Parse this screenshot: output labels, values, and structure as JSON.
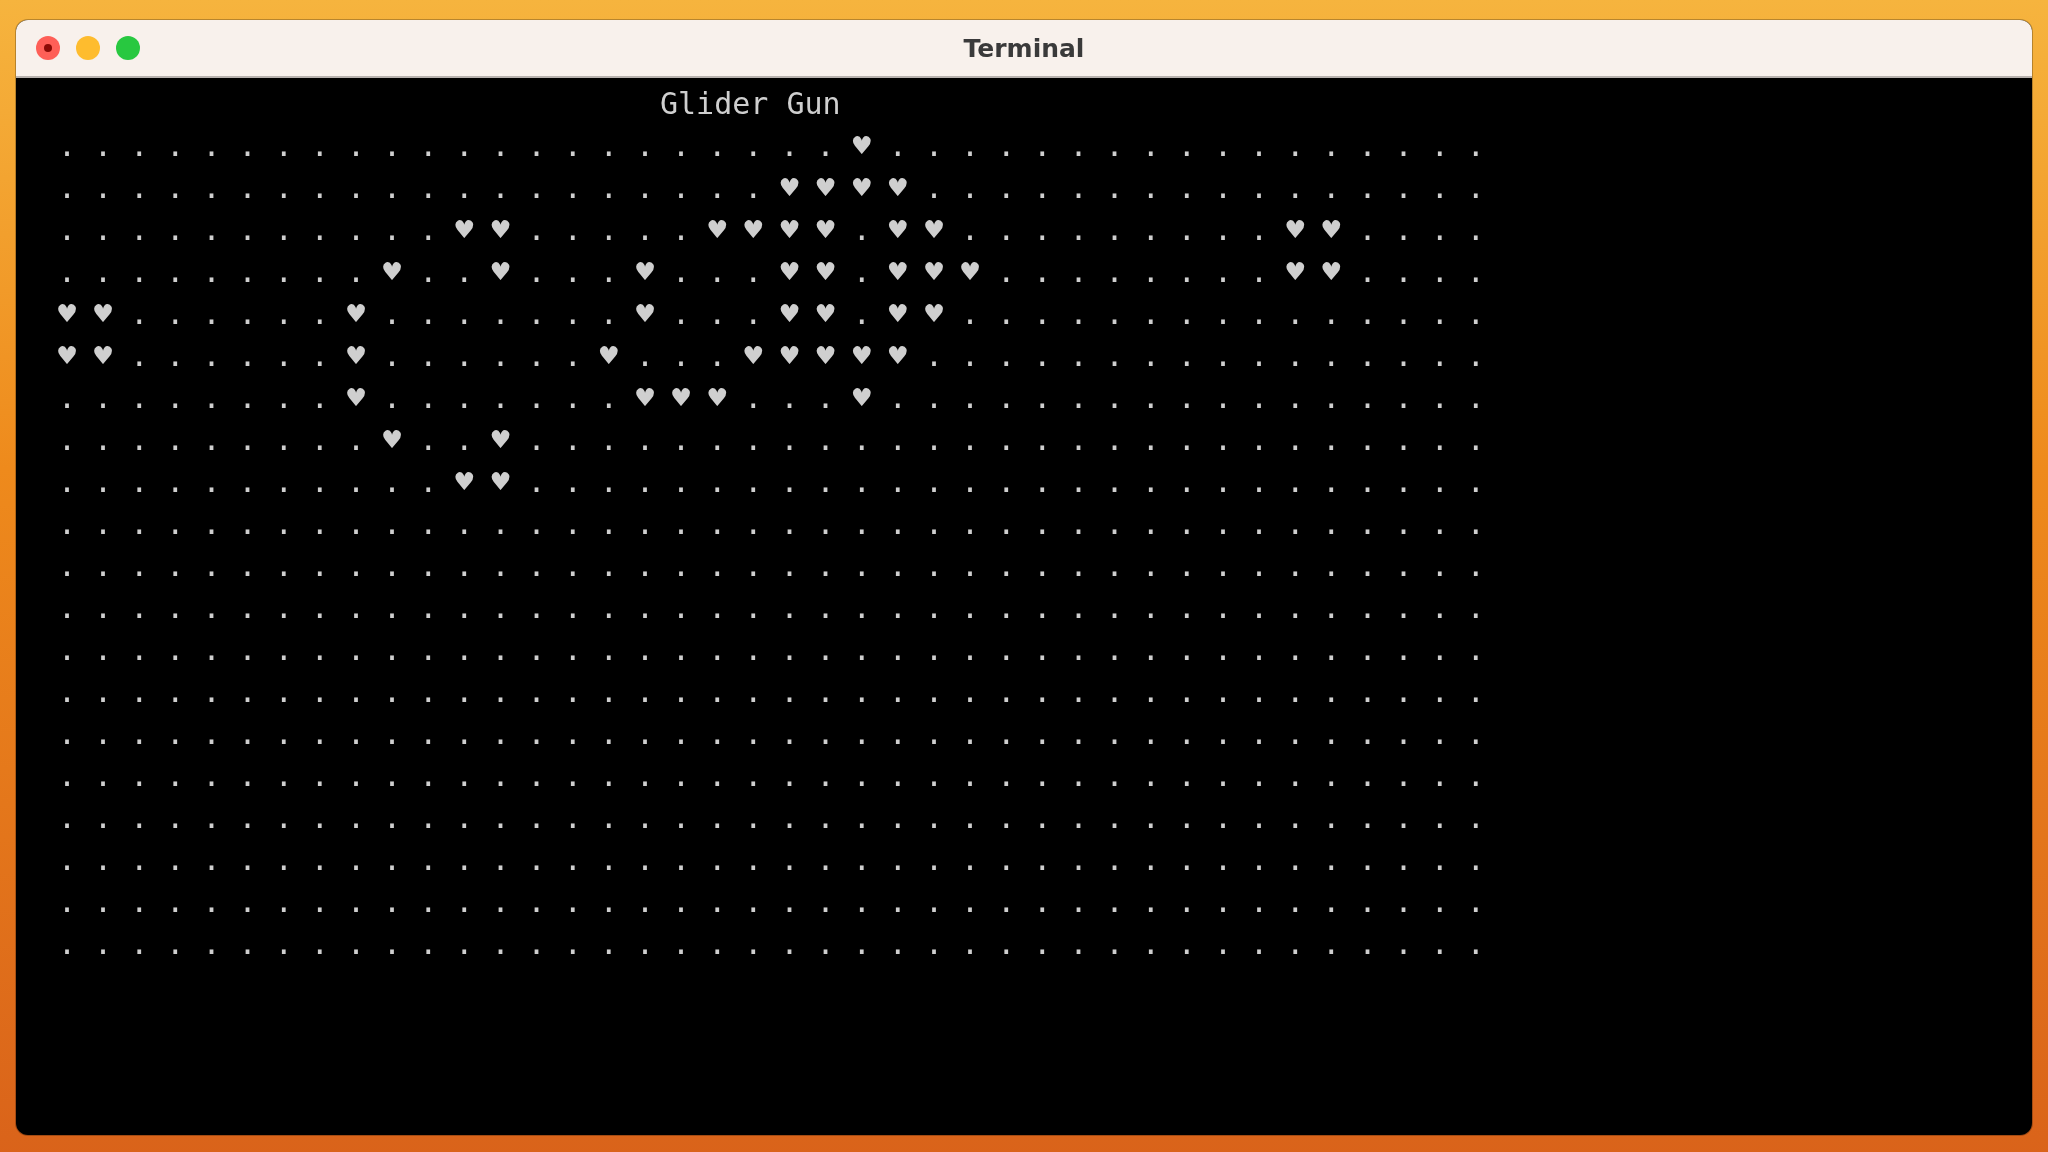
{
  "window": {
    "title": "Terminal"
  },
  "terminal": {
    "title": "Glider Gun",
    "lines": [
      ". . . . . . . . . . . . . . . . . . . . . . ♥ . . . . . . . . . . . . . . . . .",
      ". . . . . . . . . . . . . . . . . . . . ♥ ♥ ♥ ♥ . . . . . . . . . . . . . . . .",
      ". . . . . . . . . . . ♥ ♥ . . . . . ♥ ♥ ♥ ♥ . ♥ ♥ . . . . . . . . . ♥ ♥ . . . .",
      ". . . . . . . . . ♥ . . ♥ . . . ♥ . . . ♥ ♥ . ♥ ♥ ♥ . . . . . . . . ♥ ♥ . . . .",
      "♥ ♥ . . . . . . ♥ . . . . . . . ♥ . . . ♥ ♥ . ♥ ♥ . . . . . . . . . . . . . . .",
      "♥ ♥ . . . . . . ♥ . . . . . . ♥ . . . ♥ ♥ ♥ ♥ ♥ . . . . . . . . . . . . . . . .",
      ". . . . . . . . ♥ . . . . . . . ♥ ♥ ♥ . . . ♥ . . . . . . . . . . . . . . . . .",
      ". . . . . . . . . ♥ . . ♥ . . . . . . . . . . . . . . . . . . . . . . . . . . .",
      ". . . . . . . . . . . ♥ ♥ . . . . . . . . . . . . . . . . . . . . . . . . . . .",
      ". . . . . . . . . . . . . . . . . . . . . . . . . . . . . . . . . . . . . . . .",
      ". . . . . . . . . . . . . . . . . . . . . . . . . . . . . . . . . . . . . . . .",
      ". . . . . . . . . . . . . . . . . . . . . . . . . . . . . . . . . . . . . . . .",
      ". . . . . . . . . . . . . . . . . . . . . . . . . . . . . . . . . . . . . . . .",
      ". . . . . . . . . . . . . . . . . . . . . . . . . . . . . . . . . . . . . . . .",
      ". . . . . . . . . . . . . . . . . . . . . . . . . . . . . . . . . . . . . . . .",
      ". . . . . . . . . . . . . . . . . . . . . . . . . . . . . . . . . . . . . . . .",
      ". . . . . . . . . . . . . . . . . . . . . . . . . . . . . . . . . . . . . . . .",
      ". . . . . . . . . . . . . . . . . . . . . . . . . . . . . . . . . . . . . . . .",
      ". . . . . . . . . . . . . . . . . . . . . . . . . . . . . . . . . . . . . . . .",
      ". . . . . . . . . . . . . . . . . . . . . . . . . . . . . . . . . . . . . . . ."
    ]
  }
}
